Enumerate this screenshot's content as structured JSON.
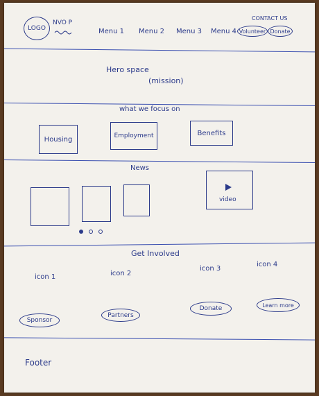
{
  "header": {
    "logo": "LOGO",
    "org": "NVO P",
    "contact": "CONTACT US",
    "menus": [
      "Menu 1",
      "Menu 2",
      "Menu 3",
      "Menu 4"
    ],
    "volunteer": "Volunteer",
    "donate": "Donate"
  },
  "hero": {
    "line1": "Hero space",
    "line2": "(mission)"
  },
  "focus": {
    "title": "what we focus on",
    "items": [
      "Housing",
      "Employment",
      "Benefits"
    ]
  },
  "news": {
    "title": "News",
    "video": "video"
  },
  "involved": {
    "title": "Get Involved",
    "icons": [
      "icon 1",
      "icon 2",
      "icon 3",
      "icon 4"
    ],
    "buttons": [
      "Sponsor",
      "Partners",
      "Donate",
      "Learn more"
    ]
  },
  "footer": {
    "label": "Footer"
  }
}
